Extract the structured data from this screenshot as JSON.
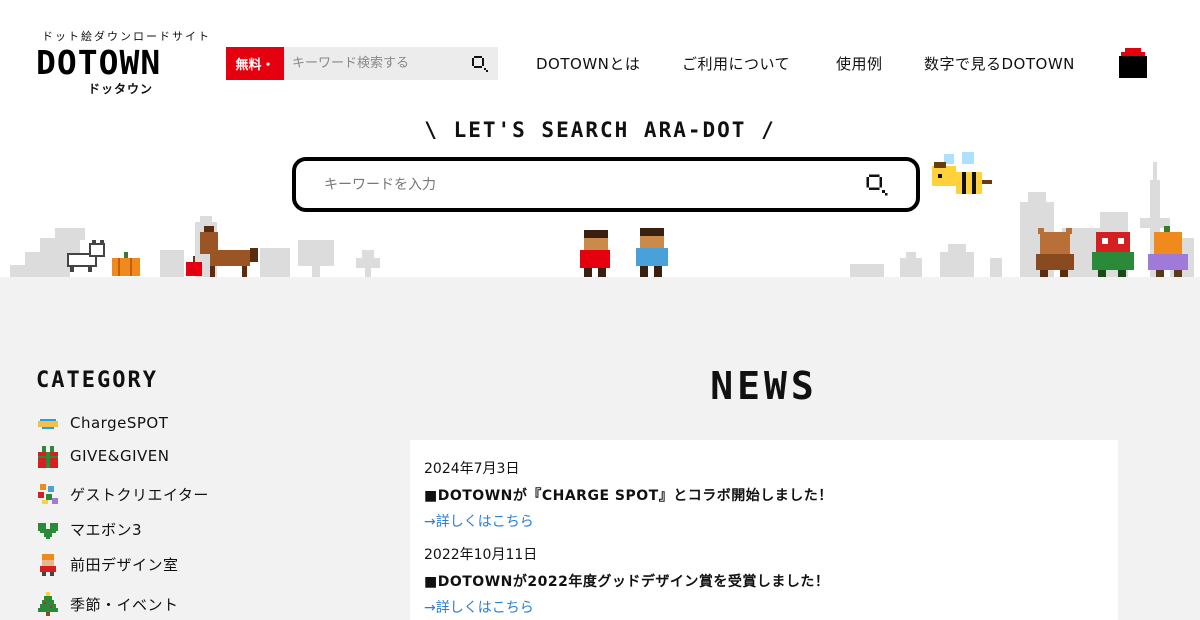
{
  "header": {
    "tagline": "ドット絵ダウンロードサイト",
    "logo_text": "DOTOWN",
    "logo_kana": "ドッタウン",
    "free_badge": "無料・",
    "search_placeholder": "キーワード検索する"
  },
  "nav": {
    "items": [
      {
        "label": "DOTOWNとは"
      },
      {
        "label": "ご利用について"
      },
      {
        "label": "使用例"
      },
      {
        "label": "数字で見るDOTOWN"
      }
    ]
  },
  "hero": {
    "title": "\\ LET'S SEARCH ARA-DOT /",
    "search_placeholder": "キーワードを入力"
  },
  "category": {
    "title": "CATEGORY",
    "items": [
      {
        "label": "ChargeSPOT",
        "icon": "charge-spot-icon"
      },
      {
        "label": "GIVE&GIVEN",
        "icon": "gift-icon"
      },
      {
        "label": "ゲストクリエイター",
        "icon": "guest-creator-icon"
      },
      {
        "label": "マエボン3",
        "icon": "green-heart-icon"
      },
      {
        "label": "前田デザイン室",
        "icon": "maeda-icon"
      },
      {
        "label": "季節・イベント",
        "icon": "tree-icon"
      }
    ]
  },
  "news": {
    "title": "NEWS",
    "items": [
      {
        "date": "2024年7月3日",
        "headline": "■DOTOWNが『CHARGE SPOT』とコラボ開始しました！",
        "link": "→詳しくはこちら"
      },
      {
        "date": "2022年10月11日",
        "headline": "■DOTOWNが2022年度グッドデザイン賞を受賞しました！",
        "link": "→詳しくはこちら"
      }
    ]
  },
  "colors": {
    "accent_red": "#e4000f",
    "link_blue": "#2a7fd4",
    "grey_bg": "#f2f2f2"
  }
}
